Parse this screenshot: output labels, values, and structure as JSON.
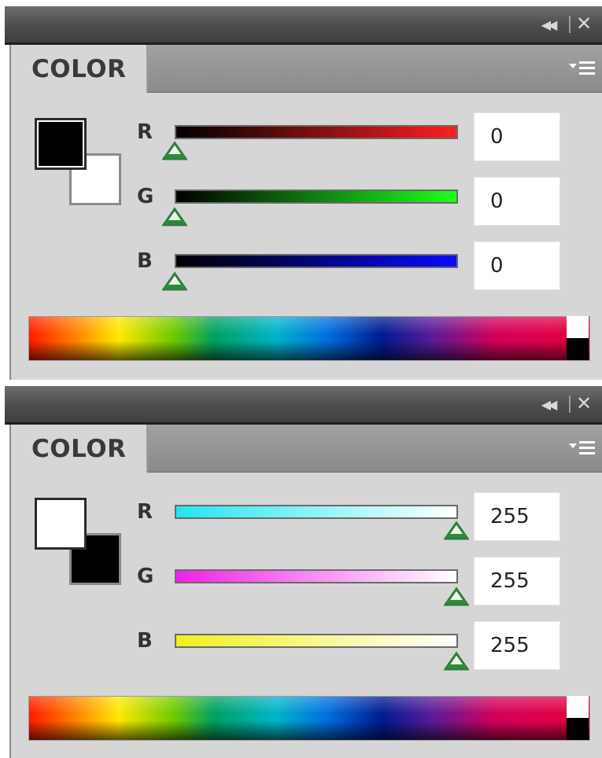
{
  "panels": [
    {
      "tab_label": "COLOR",
      "foreground_color": "#000000",
      "background_color": "#ffffff",
      "channels": [
        {
          "label": "R",
          "value": "0",
          "track_from": "#000000",
          "track_to": "#ff1e1e"
        },
        {
          "label": "G",
          "value": "0",
          "track_from": "#000000",
          "track_to": "#1eff1e"
        },
        {
          "label": "B",
          "value": "0",
          "track_from": "#000000",
          "track_to": "#0a0aff"
        }
      ]
    },
    {
      "tab_label": "COLOR",
      "foreground_color": "#ffffff",
      "background_color": "#000000",
      "channels": [
        {
          "label": "R",
          "value": "255",
          "track_from": "#22e6f0",
          "track_to": "#ffffff"
        },
        {
          "label": "G",
          "value": "255",
          "track_from": "#f020e6",
          "track_to": "#ffffff"
        },
        {
          "label": "B",
          "value": "255",
          "track_from": "#f0f020",
          "track_to": "#ffffff"
        }
      ]
    }
  ],
  "icons": {
    "collapse": "double-left-arrows",
    "close": "x",
    "menu": "panel-menu",
    "thumb": "green-triangle-slider-thumb"
  },
  "colors": {
    "title_bar": "#4f4f4f",
    "panel_bg": "#d6d6d6",
    "thumb_green": "#2e8b3a"
  }
}
